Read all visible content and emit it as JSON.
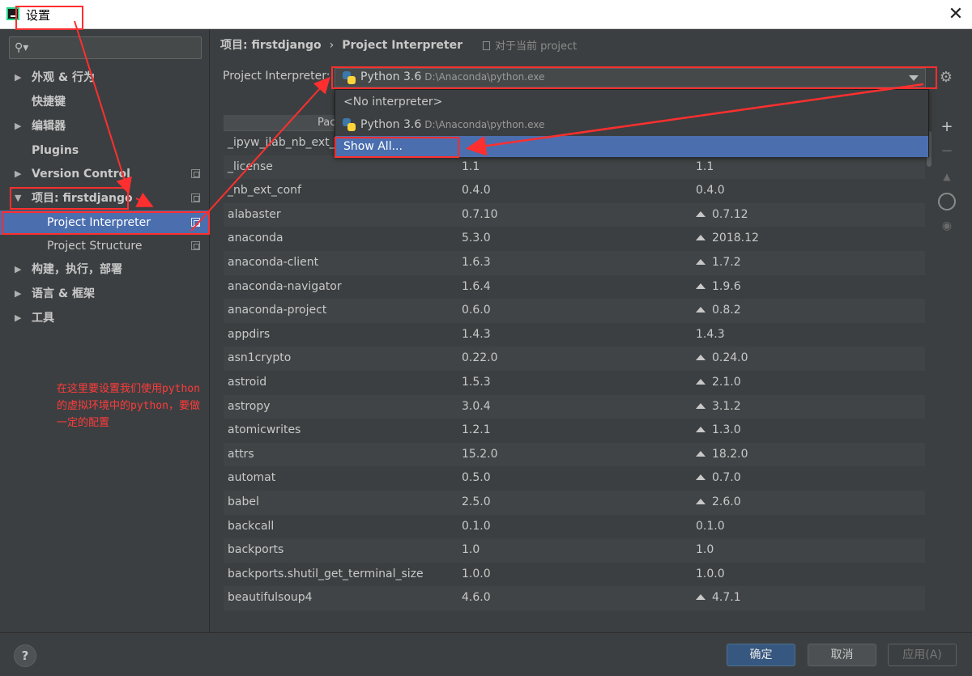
{
  "window": {
    "title": "设置",
    "close_label": "✕"
  },
  "sidebar": {
    "items": [
      {
        "label": "外观 & 行为",
        "arrow": "▶"
      },
      {
        "label": "快捷键",
        "arrow": ""
      },
      {
        "label": "编辑器",
        "arrow": "▶"
      },
      {
        "label": "Plugins",
        "arrow": ""
      },
      {
        "label": "Version Control",
        "arrow": "▶"
      },
      {
        "label": "项目: firstdjango",
        "arrow": "▼"
      },
      {
        "label": "Project Interpreter",
        "arrow": ""
      },
      {
        "label": "Project Structure",
        "arrow": ""
      },
      {
        "label": "构建，执行，部署",
        "arrow": "▶"
      },
      {
        "label": "语言 & 框架",
        "arrow": "▶"
      },
      {
        "label": "工具",
        "arrow": "▶"
      }
    ]
  },
  "annotation_note": "在这里要设置我们使用python的虚拟环境中的python，要做一定的配置",
  "breadcrumb": {
    "project": "项目: firstdjango",
    "separator": "›",
    "page": "Project Interpreter",
    "note": "对于当前 project"
  },
  "interpreter": {
    "label": "Project Interpreter:",
    "name": "Python 3.6",
    "path": "D:\\Anaconda\\python.exe"
  },
  "dropdown": {
    "options": [
      {
        "name": "<No interpreter>",
        "path": ""
      },
      {
        "name": "Python 3.6",
        "path": "D:\\Anaconda\\python.exe"
      },
      {
        "name": "Show All...",
        "path": ""
      }
    ]
  },
  "table": {
    "header_partial": "Pac",
    "rows": [
      {
        "package": "_ipyw_jlab_nb_ext_conf",
        "version": "",
        "latest": "",
        "upgrade": false
      },
      {
        "package": "_license",
        "version": "1.1",
        "latest": "1.1",
        "upgrade": false
      },
      {
        "package": "_nb_ext_conf",
        "version": "0.4.0",
        "latest": "0.4.0",
        "upgrade": false
      },
      {
        "package": "alabaster",
        "version": "0.7.10",
        "latest": "0.7.12",
        "upgrade": true
      },
      {
        "package": "anaconda",
        "version": "5.3.0",
        "latest": "2018.12",
        "upgrade": true
      },
      {
        "package": "anaconda-client",
        "version": "1.6.3",
        "latest": "1.7.2",
        "upgrade": true
      },
      {
        "package": "anaconda-navigator",
        "version": "1.6.4",
        "latest": "1.9.6",
        "upgrade": true
      },
      {
        "package": "anaconda-project",
        "version": "0.6.0",
        "latest": "0.8.2",
        "upgrade": true
      },
      {
        "package": "appdirs",
        "version": "1.4.3",
        "latest": "1.4.3",
        "upgrade": false
      },
      {
        "package": "asn1crypto",
        "version": "0.22.0",
        "latest": "0.24.0",
        "upgrade": true
      },
      {
        "package": "astroid",
        "version": "1.5.3",
        "latest": "2.1.0",
        "upgrade": true
      },
      {
        "package": "astropy",
        "version": "3.0.4",
        "latest": "3.1.2",
        "upgrade": true
      },
      {
        "package": "atomicwrites",
        "version": "1.2.1",
        "latest": "1.3.0",
        "upgrade": true
      },
      {
        "package": "attrs",
        "version": "15.2.0",
        "latest": "18.2.0",
        "upgrade": true
      },
      {
        "package": "automat",
        "version": "0.5.0",
        "latest": "0.7.0",
        "upgrade": true
      },
      {
        "package": "babel",
        "version": "2.5.0",
        "latest": "2.6.0",
        "upgrade": true
      },
      {
        "package": "backcall",
        "version": "0.1.0",
        "latest": "0.1.0",
        "upgrade": false
      },
      {
        "package": "backports",
        "version": "1.0",
        "latest": "1.0",
        "upgrade": false
      },
      {
        "package": "backports.shutil_get_terminal_size",
        "version": "1.0.0",
        "latest": "1.0.0",
        "upgrade": false
      },
      {
        "package": "beautifulsoup4",
        "version": "4.6.0",
        "latest": "4.7.1",
        "upgrade": true
      }
    ]
  },
  "side_tools": {
    "add": "+",
    "remove": "−",
    "upgrade": "▲",
    "eye": "◉"
  },
  "buttons": {
    "help": "?",
    "ok": "确定",
    "cancel": "取消",
    "apply": "应用(A)"
  },
  "colors": {
    "accent_selection": "#4b6eaf",
    "annotation_red": "#ff2f2f",
    "background": "#3c3f41"
  }
}
